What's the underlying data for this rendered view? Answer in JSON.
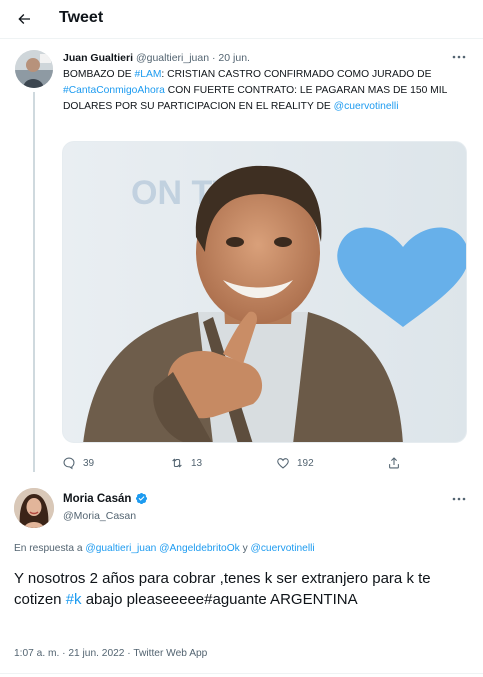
{
  "header": {
    "title": "Tweet",
    "back_icon": "arrow-left-icon"
  },
  "quoted_tweet": {
    "author_name": "Juan Gualtieri",
    "author_handle": "@gualtieri_juan",
    "separator": " · ",
    "date": "20 jun.",
    "text_parts": [
      {
        "text": "BOMBAZO DE ",
        "type": "text"
      },
      {
        "text": "#LAM",
        "type": "hashtag"
      },
      {
        "text": ": CRISTIAN CASTRO CONFIRMADO COMO JURADO DE ",
        "type": "text"
      },
      {
        "text": "#CantaConmigoAhora",
        "type": "hashtag"
      },
      {
        "text": " CON FUERTE CONTRATO: LE PAGARAN MAS DE 150 MIL DOLARES POR SU PARTICIPACION EN EL REALITY DE ",
        "type": "text"
      },
      {
        "text": "@cuervotinelli",
        "type": "mention"
      }
    ],
    "media_backdrop_text": "ON TV",
    "stats": {
      "replies": "39",
      "retweets": "13",
      "likes": "192"
    },
    "accent_color": "#1d9bf0",
    "heart_color": "#67b0ea"
  },
  "main_tweet": {
    "author_name": "Moria Casán",
    "author_handle": "@Moria_Casan",
    "verified_icon": "verified-badge-icon",
    "reply_prefix": "En respuesta a ",
    "reply_mentions": [
      "@gualtieri_juan",
      "@AngeldebritoOk",
      "@cuervotinelli"
    ],
    "reply_and": " y ",
    "text_parts": [
      {
        "text": "Y nosotros 2 años para cobrar ,tenes k ser extranjero para k te cotizen ",
        "type": "text"
      },
      {
        "text": "#k",
        "type": "hashtag"
      },
      {
        "text": " abajo pleaseeeee#aguante ARGENTINA",
        "type": "text"
      }
    ],
    "time": "1:07 a. m.",
    "date": "21 jun. 2022",
    "source": "Twitter Web App",
    "meta_separator": " · "
  }
}
